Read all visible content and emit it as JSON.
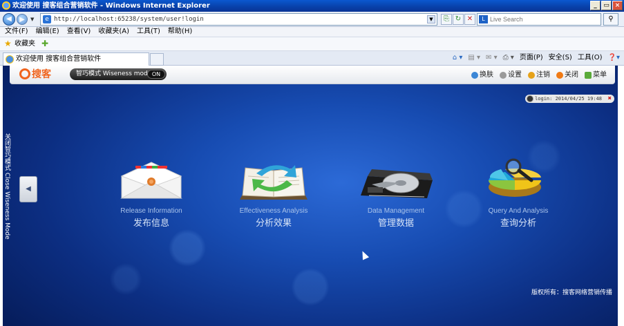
{
  "window": {
    "title": "欢迎使用 搜客组合营销软件 - Windows Internet Explorer",
    "controls": [
      "_",
      "▭",
      "×"
    ]
  },
  "addressbar": {
    "url": "http://localhost:65238/system/user!login",
    "search_placeholder": "Live Search"
  },
  "menu": [
    "文件(F)",
    "编辑(E)",
    "查看(V)",
    "收藏夹(A)",
    "工具(T)",
    "帮助(H)"
  ],
  "favorites": {
    "label": "收藏夹"
  },
  "tab": {
    "title": "欢迎使用 搜客组合营销软件"
  },
  "commandbar": [
    "页面(P)",
    "安全(S)",
    "工具(O)"
  ],
  "app": {
    "brand": "搜客",
    "mode_label": "智巧模式 Wiseness model",
    "mode_state": "ON",
    "header_links": [
      {
        "label": "换肤",
        "color": "#3b86d6"
      },
      {
        "label": "设置",
        "color": "#8f8f8f"
      },
      {
        "label": "注销",
        "color": "#e6a21a"
      },
      {
        "label": "关闭",
        "color": "#f07a14"
      },
      {
        "label": "菜单",
        "color": "#5aaa3a"
      }
    ],
    "login_info": "login: 2014/04/25 19:48",
    "side_tab": "关闭智巧模式 Close Wiseness Mode",
    "modules": [
      {
        "en": "Release Information",
        "zh": "发布信息",
        "icon": "envelope-icon"
      },
      {
        "en": "Effectiveness Analysis",
        "zh": "分析效果",
        "icon": "book-refresh-icon"
      },
      {
        "en": "Data Management",
        "zh": "管理数据",
        "icon": "hard-drive-icon"
      },
      {
        "en": "Query And Analysis",
        "zh": "查询分析",
        "icon": "pie-chart-magnifier-icon"
      }
    ],
    "copyright": "版权所有：搜客网络营销传播"
  }
}
